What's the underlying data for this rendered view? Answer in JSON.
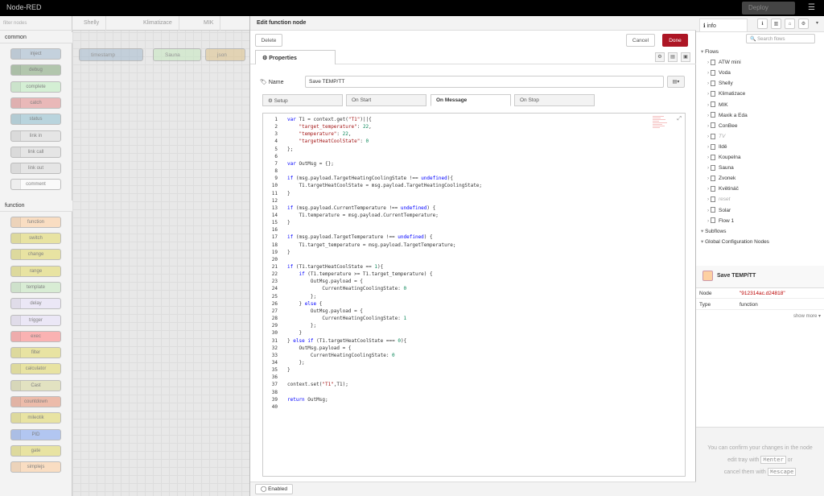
{
  "header": {
    "app_name": "Node-RED",
    "deploy_label": "Deploy",
    "menu_icon": "hamburger-icon"
  },
  "palette": {
    "filter_placeholder": "filter nodes",
    "categories": [
      {
        "name": "common",
        "nodes": [
          "inject",
          "debug",
          "complete",
          "catch",
          "status",
          "link in",
          "link call",
          "link out",
          "comment"
        ]
      },
      {
        "name": "function",
        "nodes": [
          "function",
          "switch",
          "change",
          "range",
          "template",
          "delay",
          "trigger",
          "exec",
          "filter",
          "calculator",
          "Cast",
          "countdown",
          "mileotik",
          "PID",
          "gate",
          "simplejs"
        ]
      }
    ]
  },
  "workspace": {
    "tabs": [
      "Shelly",
      "Klimatizace",
      "MIK"
    ],
    "nodes": [
      "timestamp",
      "Sauna",
      "json"
    ]
  },
  "editor": {
    "title": "Edit function node",
    "delete_label": "Delete",
    "cancel_label": "Cancel",
    "done_label": "Done",
    "properties_tab": "Properties",
    "name_label": "Name",
    "name_value": "Save TEMP/TT",
    "sub_tabs": [
      "Setup",
      "On Start",
      "On Message",
      "On Stop"
    ],
    "active_sub_tab": "On Message",
    "enabled_label": "Enabled"
  },
  "code_lines": [
    "var T1 = context.get(\"T1\")||{",
    "    \"target_temperature\": 22,",
    "    \"temperature\": 22,",
    "    \"targetHeatCoolState\": 0",
    "};",
    "",
    "var OutMsg = {};",
    "",
    "if (msg.payload.TargetHeatingCoolingState !== undefined){",
    "    T1.targetHeatCoolState = msg.payload.TargetHeatingCoolingState;",
    "}",
    "",
    "if (msg.payload.CurrentTemperature !== undefined) {",
    "    T1.temperature = msg.payload.CurrentTemperature;",
    "}",
    "",
    "if (msg.payload.TargetTemperature !== undefined) {",
    "    T1.target_temperature = msg.payload.TargetTemperature;",
    "}",
    "",
    "if (T1.targetHeatCoolState == 1){",
    "    if (T1.temperature >= T1.target_temperature) {",
    "        OutMsg.payload = {",
    "            CurrentHeatingCoolingState: 0",
    "        };",
    "    } else {",
    "        OutMsg.payload = {",
    "            CurrentHeatingCoolingState: 1",
    "        };",
    "    }",
    "} else if (T1.targetHeatCoolState === 0){",
    "    OutMsg.payload = {",
    "        CurrentHeatingCoolingState: 0",
    "    };",
    "}",
    "",
    "context.set(\"T1\",T1);",
    "",
    "return OutMsg;",
    ""
  ],
  "sidebar": {
    "tab_label": "info",
    "search_placeholder": "Search flows",
    "tree_root": "Flows",
    "flows": [
      {
        "name": "ATW mini",
        "dim": false
      },
      {
        "name": "Voda",
        "dim": false
      },
      {
        "name": "Shelly",
        "dim": false
      },
      {
        "name": "Klimatizace",
        "dim": false
      },
      {
        "name": "MIK",
        "dim": false
      },
      {
        "name": "Maxik a Eda",
        "dim": false
      },
      {
        "name": "ConBee",
        "dim": false
      },
      {
        "name": "TV",
        "dim": true
      },
      {
        "name": "Ildě",
        "dim": false
      },
      {
        "name": "Koupelna",
        "dim": false
      },
      {
        "name": "Sauna",
        "dim": false
      },
      {
        "name": "Zvonek",
        "dim": false
      },
      {
        "name": "Květináč",
        "dim": false
      },
      {
        "name": "reset",
        "dim": true
      },
      {
        "name": "Solar",
        "dim": false
      },
      {
        "name": "Flow 1",
        "dim": false
      }
    ],
    "subflows_label": "Subflows",
    "global_label": "Global Configuration Nodes",
    "node_name": "Save TEMP/TT",
    "node_key": "Node",
    "node_value": "\"912314ac.d24818\"",
    "type_key": "Type",
    "type_value": "function",
    "show_more": "show more ▾",
    "tip_1": "You can confirm your changes in the node edit tray with",
    "tip_key_1": "⌘enter",
    "tip_or": "or",
    "tip_2": "cancel them with",
    "tip_key_2": "⌘escape"
  },
  "colors": {
    "done": "#ad1625",
    "header": "#000000"
  }
}
